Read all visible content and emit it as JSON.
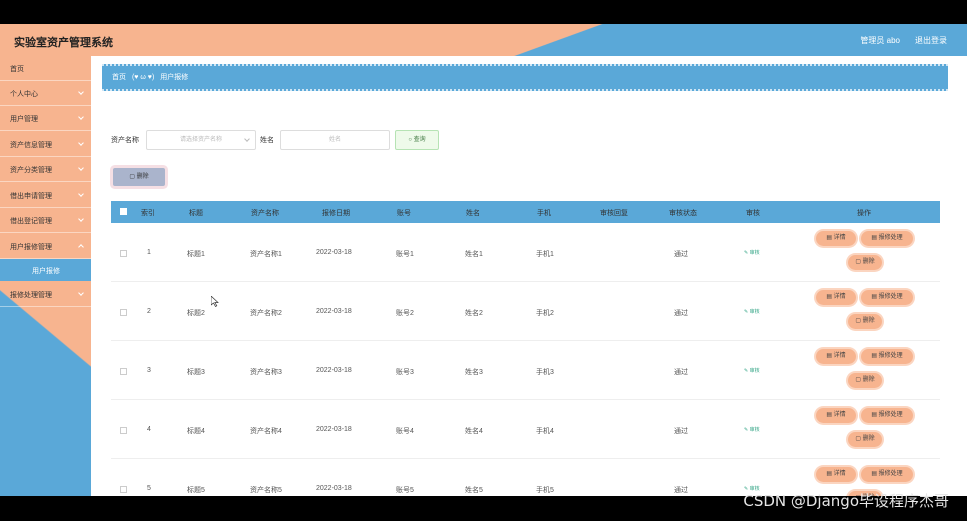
{
  "header": {
    "title": "实验室资产管理系统",
    "user": "管理员 abo",
    "logout": "退出登录"
  },
  "sidebar": {
    "items": [
      {
        "label": "首页"
      },
      {
        "label": "个人中心"
      },
      {
        "label": "用户管理"
      },
      {
        "label": "资产信息管理"
      },
      {
        "label": "资产分类管理"
      },
      {
        "label": "借出申请管理"
      },
      {
        "label": "借出登记管理"
      },
      {
        "label": "用户报修管理"
      }
    ],
    "active_sub": "用户报修",
    "last_item": "报修处理管理"
  },
  "breadcrumb": {
    "home": "首页",
    "emoticon": "(♥ ω ♥)",
    "current": "用户报修"
  },
  "filter": {
    "asset_label": "资产名称",
    "asset_placeholder": "请选择资产名称",
    "name_label": "姓名",
    "name_placeholder": "姓名",
    "query_label": "查询"
  },
  "toolbar": {
    "delete_label": "删除"
  },
  "table": {
    "headers": [
      "索引",
      "标题",
      "资产名称",
      "报修日期",
      "账号",
      "姓名",
      "手机",
      "审核回复",
      "审核状态",
      "审核",
      "操作"
    ],
    "rows": [
      {
        "index": "1",
        "title": "标题1",
        "asset": "资产名称1",
        "date": "2022-03-18",
        "account": "账号1",
        "name": "姓名1",
        "phone": "手机1",
        "reply": "",
        "status": "通过",
        "audit": "审核"
      },
      {
        "index": "2",
        "title": "标题2",
        "asset": "资产名称2",
        "date": "2022-03-18",
        "account": "账号2",
        "name": "姓名2",
        "phone": "手机2",
        "reply": "",
        "status": "通过",
        "audit": "审核"
      },
      {
        "index": "3",
        "title": "标题3",
        "asset": "资产名称3",
        "date": "2022-03-18",
        "account": "账号3",
        "name": "姓名3",
        "phone": "手机3",
        "reply": "",
        "status": "通过",
        "audit": "审核"
      },
      {
        "index": "4",
        "title": "标题4",
        "asset": "资产名称4",
        "date": "2022-03-18",
        "account": "账号4",
        "name": "姓名4",
        "phone": "手机4",
        "reply": "",
        "status": "通过",
        "audit": "审核"
      },
      {
        "index": "5",
        "title": "标题5",
        "asset": "资产名称5",
        "date": "2022-03-18",
        "account": "账号5",
        "name": "姓名5",
        "phone": "手机5",
        "reply": "",
        "status": "通过",
        "audit": "审核"
      }
    ],
    "actions": {
      "detail": "详情",
      "repair": "报修处理",
      "delete": "删除"
    }
  },
  "watermark": "CSDN @Django毕设程序杰哥",
  "colors": {
    "peach": "#f7b48f",
    "blue": "#5aa8d8"
  }
}
